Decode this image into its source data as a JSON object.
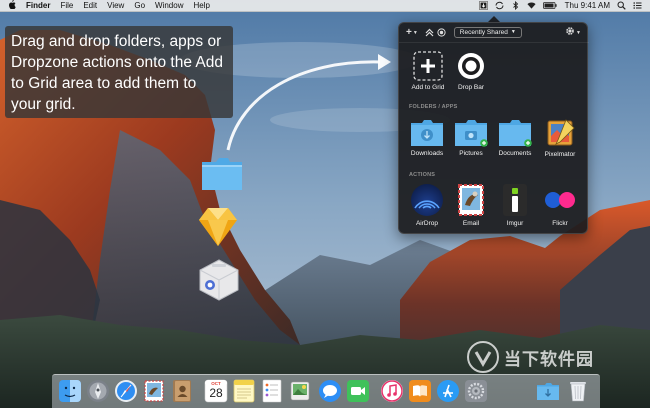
{
  "menubar": {
    "app_name": "Finder",
    "items": [
      "File",
      "Edit",
      "View",
      "Go",
      "Window",
      "Help"
    ],
    "clock": "Thu 9:41 AM"
  },
  "caption": {
    "text": "Drag and drop folders, apps or Dropzone actions onto the Add to Grid area to add them to your grid."
  },
  "panel": {
    "toolbar": {
      "add_label": "+",
      "dropdown_value": "Recently Shared"
    },
    "top_items": [
      {
        "label": "Add to Grid",
        "icon": "plus-square-icon"
      },
      {
        "label": "Drop Bar",
        "icon": "drop-bar-icon"
      }
    ],
    "folders_section_label": "FOLDERS / APPS",
    "folders": [
      {
        "label": "Downloads",
        "icon": "downloads-folder-icon"
      },
      {
        "label": "Pictures",
        "icon": "pictures-folder-icon"
      },
      {
        "label": "Documents",
        "icon": "documents-folder-icon"
      },
      {
        "label": "Pixelmator",
        "icon": "pixelmator-icon"
      }
    ],
    "actions_section_label": "ACTIONS",
    "actions": [
      {
        "label": "AirDrop",
        "icon": "airdrop-icon"
      },
      {
        "label": "Email",
        "icon": "email-icon"
      },
      {
        "label": "Imgur",
        "icon": "imgur-icon"
      },
      {
        "label": "Flickr",
        "icon": "flickr-icon"
      }
    ]
  },
  "dock": {
    "calendar_month": "OCT",
    "calendar_day": "28"
  },
  "watermark": {
    "text": "当下软件园"
  }
}
